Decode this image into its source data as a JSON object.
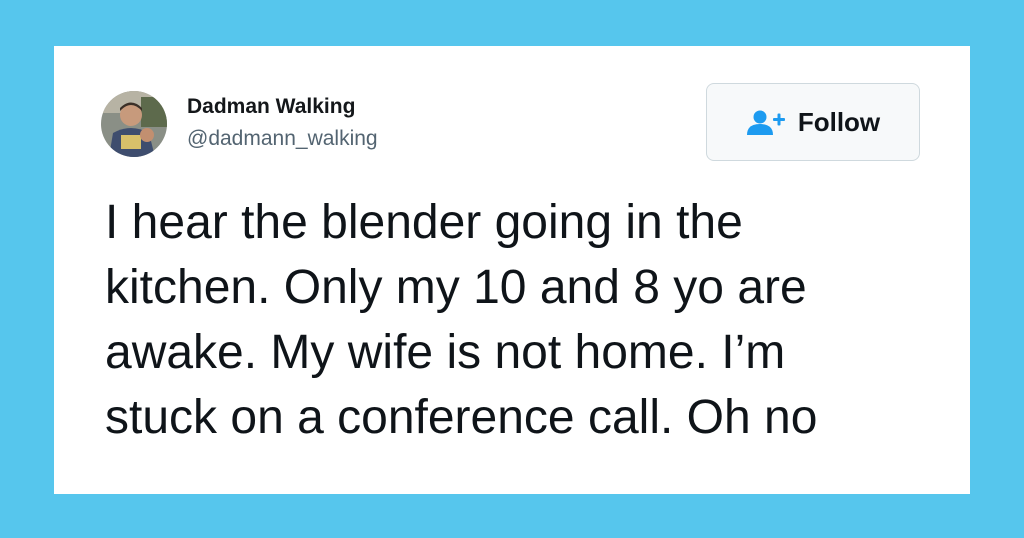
{
  "tweet": {
    "author": {
      "display_name": "Dadman Walking",
      "handle": "@dadmann_walking",
      "avatar_icon": "profile-photo"
    },
    "follow_button": {
      "label": "Follow",
      "icon": "add-user-icon",
      "icon_color": "#1d9bf0"
    },
    "text_lines": [
      "I hear the blender going in the",
      "kitchen. Only my 10 and 8 yo are",
      "awake. My wife is not home. I’m",
      "stuck on a conference call. Oh no"
    ]
  },
  "colors": {
    "background": "#56c6ed",
    "card": "#ffffff",
    "text": "#0f1419",
    "handle": "#536471"
  }
}
